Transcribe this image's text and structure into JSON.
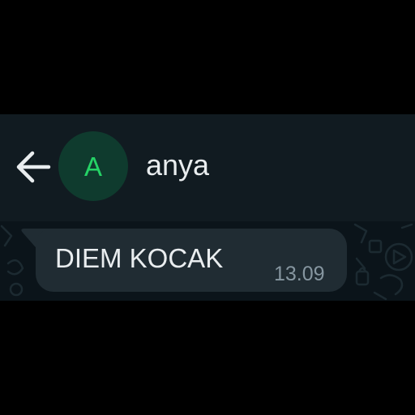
{
  "header": {
    "back_icon": "arrow-left-icon",
    "avatar_letter": "A",
    "contact_name": "anya"
  },
  "messages": [
    {
      "direction": "incoming",
      "text": "DIEM KOCAK",
      "time": "13.09"
    }
  ],
  "colors": {
    "header_bg": "#111b21",
    "chat_bg": "#0b141a",
    "bubble_bg": "#202c33",
    "avatar_bg": "#0f3b2e",
    "avatar_letter": "#25d366",
    "primary_text": "#e9edef",
    "secondary_text": "#8696a0",
    "frame_bg": "#000000"
  }
}
